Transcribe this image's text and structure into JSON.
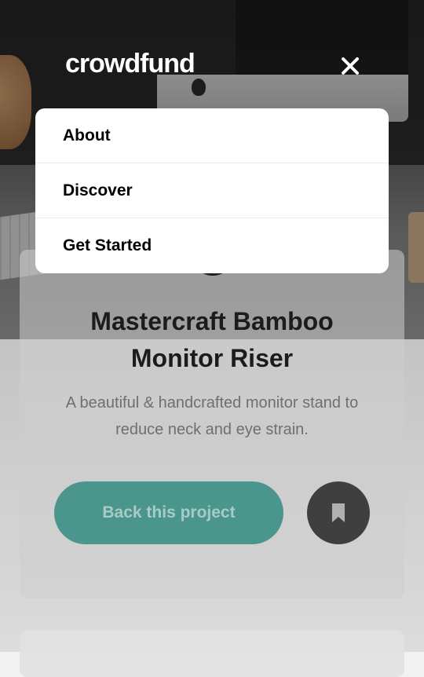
{
  "header": {
    "logo_text": "crowdfund",
    "close_icon": "close-icon"
  },
  "menu": {
    "items": [
      {
        "label": "About"
      },
      {
        "label": "Discover"
      },
      {
        "label": "Get Started"
      }
    ]
  },
  "project": {
    "title": "Mastercraft Bamboo Monitor Riser",
    "description": "A beautiful & handcrafted monitor stand to reduce neck and eye strain.",
    "back_button_label": "Back this project",
    "bookmark_icon": "bookmark-icon"
  },
  "colors": {
    "accent": "#3cb4ac",
    "menu_background": "#ffffff",
    "bookmark_button": "#2f2f2f"
  }
}
